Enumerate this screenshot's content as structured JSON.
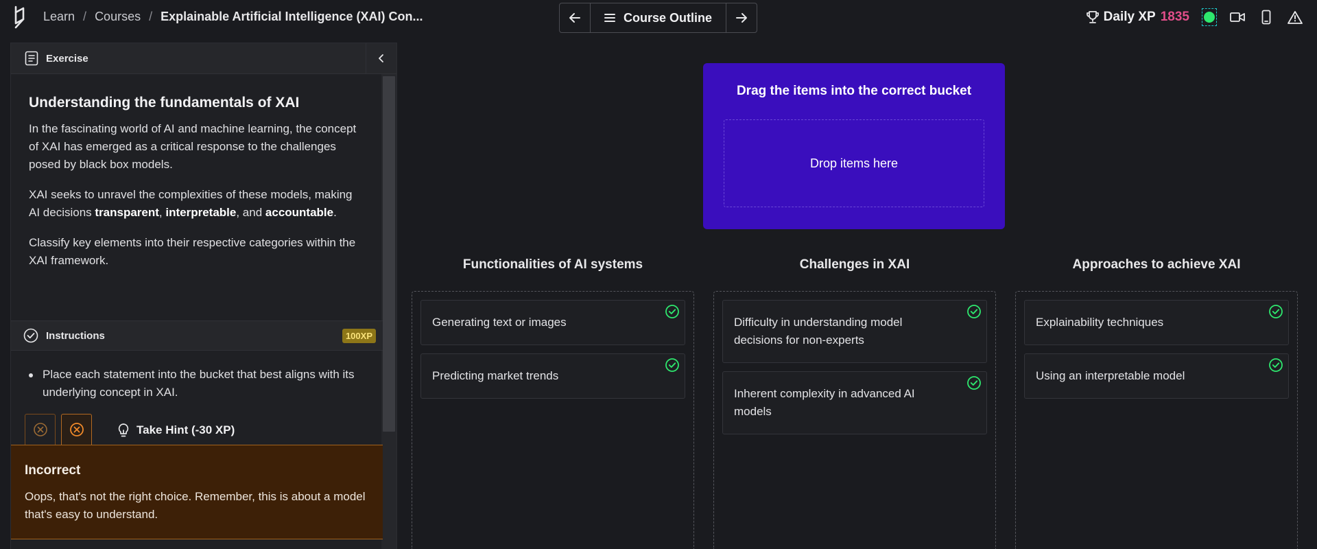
{
  "header": {
    "breadcrumb": [
      "Learn",
      "Courses",
      "Explainable Artificial Intelligence (XAI) Con..."
    ],
    "separator": "/",
    "outline_label": "Course Outline",
    "daily_xp_label": "Daily XP",
    "daily_xp_value": "1835"
  },
  "exercise": {
    "header_label": "Exercise",
    "title": "Understanding the fundamentals of XAI",
    "paragraph_1": "In the fascinating world of AI and machine learning, the concept of XAI has emerged as a critical response to the challenges posed by black box models.",
    "paragraph_2_prefix": "XAI seeks to unravel the complexities of these models, making AI decisions ",
    "paragraph_2_bold_1": "transparent",
    "paragraph_2_comma": ", ",
    "paragraph_2_bold_2": "interpretable",
    "paragraph_2_and": ", and ",
    "paragraph_2_bold_3": "accountable",
    "paragraph_2_end": ".",
    "paragraph_3": "Classify key elements into their respective categories within the XAI framework."
  },
  "instructions": {
    "header_label": "Instructions",
    "xp_badge": "100XP",
    "items": [
      "Place each statement into the bucket that best aligns with its underlying concept in XAI."
    ],
    "hint_label": "Take Hint (-30 XP)"
  },
  "feedback": {
    "title": "Incorrect",
    "message": "Oops, that's not the right choice. Remember, this is about a model that's easy to understand."
  },
  "dropzone": {
    "title": "Drag the items into the correct bucket",
    "placeholder": "Drop items here"
  },
  "buckets": [
    {
      "title": "Functionalities of AI systems",
      "items": [
        "Generating text or images",
        "Predicting market trends"
      ]
    },
    {
      "title": "Challenges in XAI",
      "items": [
        "Difficulty in understanding model decisions for non-experts",
        "Inherent complexity in advanced AI models"
      ]
    },
    {
      "title": "Approaches to achieve XAI",
      "items": [
        "Explainability techniques",
        "Using an interpretable model"
      ]
    }
  ],
  "colors": {
    "accent_purple": "#3a0ebd",
    "xp_pink": "#e24e8a",
    "check_green": "#2ee86e",
    "feedback_bg": "#3d2007"
  }
}
